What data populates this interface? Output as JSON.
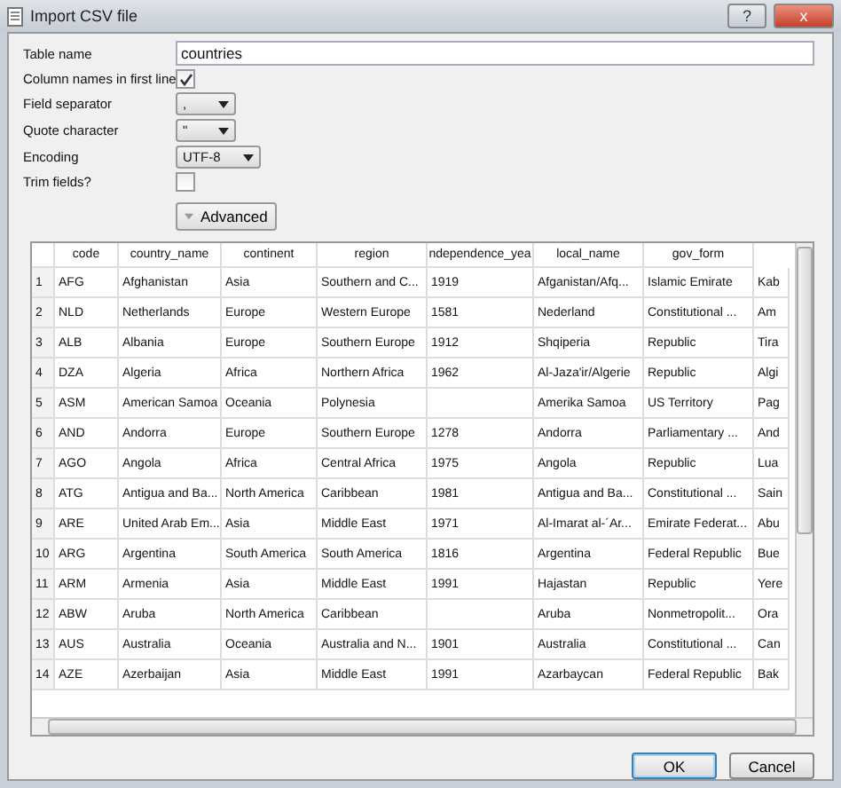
{
  "window": {
    "title": "Import CSV file",
    "help": "?",
    "close": "x"
  },
  "form": {
    "table_name": {
      "label": "Table name",
      "value": "countries"
    },
    "column_names": {
      "label": "Column names in first line",
      "checked": true
    },
    "field_separator": {
      "label": "Field separator",
      "value": ","
    },
    "quote_character": {
      "label": "Quote character",
      "value": "\""
    },
    "encoding": {
      "label": "Encoding",
      "value": "UTF-8"
    },
    "trim_fields": {
      "label": "Trim fields?",
      "checked": false
    },
    "advanced": "Advanced"
  },
  "table": {
    "columns": [
      "code",
      "country_name",
      "continent",
      "region",
      "ndependence_yea",
      "local_name",
      "gov_form"
    ],
    "rows": [
      {
        "number": "1",
        "cells": [
          "AFG",
          "Afghanistan",
          "Asia",
          "Southern and C...",
          "1919",
          "Afganistan/Afq...",
          "Islamic Emirate",
          "Kab"
        ]
      },
      {
        "number": "2",
        "cells": [
          "NLD",
          "Netherlands",
          "Europe",
          "Western Europe",
          "1581",
          "Nederland",
          "Constitutional ...",
          "Am"
        ]
      },
      {
        "number": "3",
        "cells": [
          "ALB",
          "Albania",
          "Europe",
          "Southern Europe",
          "1912",
          "Shqiperia",
          "Republic",
          "Tira"
        ]
      },
      {
        "number": "4",
        "cells": [
          "DZA",
          "Algeria",
          "Africa",
          "Northern Africa",
          "1962",
          "Al-Jaza'ir/Algerie",
          "Republic",
          "Algi"
        ]
      },
      {
        "number": "5",
        "cells": [
          "ASM",
          "American Samoa",
          "Oceania",
          "Polynesia",
          "",
          "Amerika Samoa",
          "US Territory",
          "Pag"
        ]
      },
      {
        "number": "6",
        "cells": [
          "AND",
          "Andorra",
          "Europe",
          "Southern Europe",
          "1278",
          "Andorra",
          "Parliamentary ...",
          "And"
        ]
      },
      {
        "number": "7",
        "cells": [
          "AGO",
          "Angola",
          "Africa",
          "Central Africa",
          "1975",
          "Angola",
          "Republic",
          "Lua"
        ]
      },
      {
        "number": "8",
        "cells": [
          "ATG",
          "Antigua and Ba...",
          "North America",
          "Caribbean",
          "1981",
          "Antigua and Ba...",
          "Constitutional ...",
          "Sain"
        ]
      },
      {
        "number": "9",
        "cells": [
          "ARE",
          "United Arab Em...",
          "Asia",
          "Middle East",
          "1971",
          "Al-Imarat al-´Ar...",
          "Emirate Federat...",
          "Abu"
        ]
      },
      {
        "number": "10",
        "cells": [
          "ARG",
          "Argentina",
          "South America",
          "South America",
          "1816",
          "Argentina",
          "Federal Republic",
          "Bue"
        ]
      },
      {
        "number": "11",
        "cells": [
          "ARM",
          "Armenia",
          "Asia",
          "Middle East",
          "1991",
          "Hajastan",
          "Republic",
          "Yere"
        ]
      },
      {
        "number": "12",
        "cells": [
          "ABW",
          "Aruba",
          "North America",
          "Caribbean",
          "",
          "Aruba",
          "Nonmetropolit...",
          "Ora"
        ]
      },
      {
        "number": "13",
        "cells": [
          "AUS",
          "Australia",
          "Oceania",
          "Australia and N...",
          "1901",
          "Australia",
          "Constitutional ...",
          "Can"
        ]
      },
      {
        "number": "14",
        "cells": [
          "AZE",
          "Azerbaijan",
          "Asia",
          "Middle East",
          "1991",
          "Azarbaycan",
          "Federal Republic",
          "Bak"
        ]
      }
    ]
  },
  "buttons": [
    {
      "label": "OK",
      "default": true
    },
    {
      "label": "Cancel",
      "default": false
    }
  ]
}
